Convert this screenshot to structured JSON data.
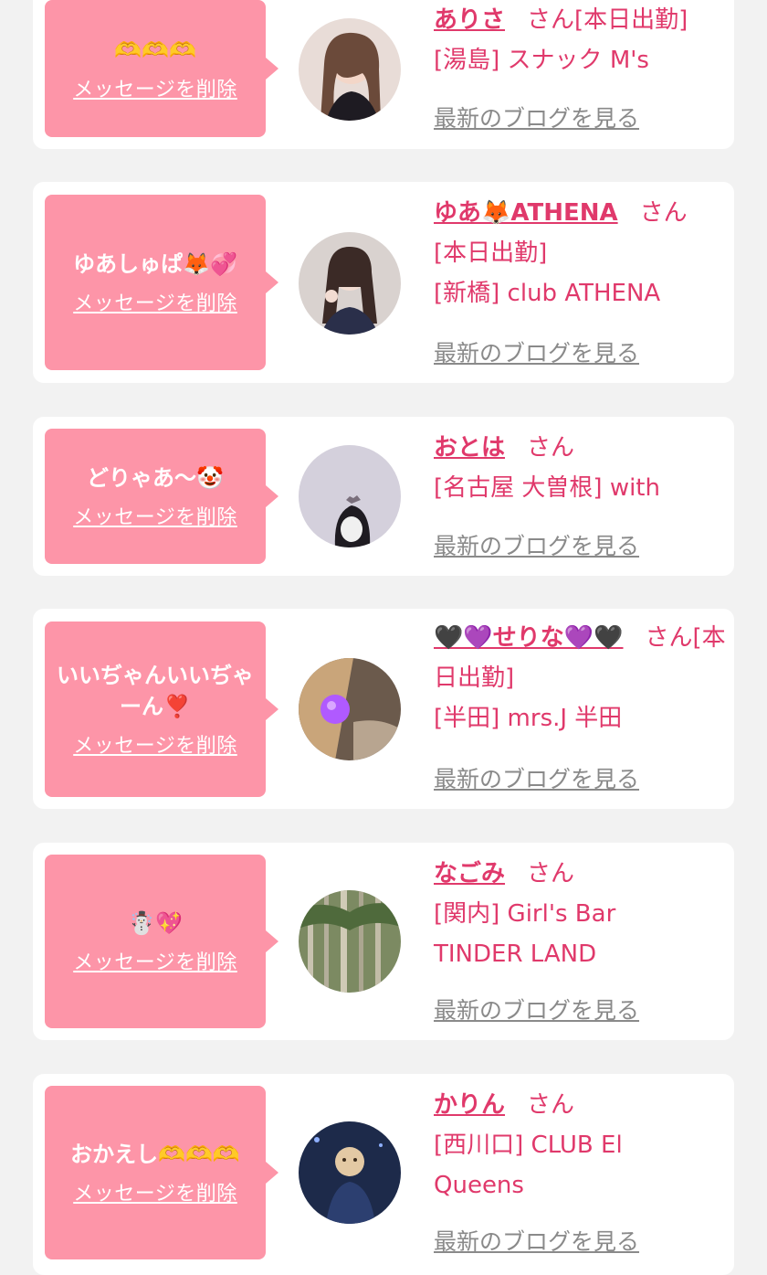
{
  "entries": [
    {
      "message": "🫶🫶🫶",
      "delete_label": "メッセージを削除",
      "name": "ありさ",
      "san": "さん",
      "lines": [
        "[本日出勤]",
        "[湯島] スナック M's"
      ],
      "blog_label": "最新のブログを見る"
    },
    {
      "message": "ゆあしゅぱ🦊💞",
      "delete_label": "メッセージを削除",
      "name": "ゆあ🦊ATHENA",
      "san": "さん",
      "lines": [
        "[本日出勤]",
        "[新橋] club ATHENA"
      ],
      "blog_label": "最新のブログを見る"
    },
    {
      "message": "どりゃあ〜🤡",
      "delete_label": "メッセージを削除",
      "name": "おとは",
      "san": "さん",
      "lines": [
        "[名古屋 大曽根] with"
      ],
      "blog_label": "最新のブログを見る"
    },
    {
      "message": "いいぢゃんいいぢゃーん❣️",
      "delete_label": "メッセージを削除",
      "name": "🖤💜せりな💜🖤",
      "san": "さん",
      "lines": [
        "[本日出勤]",
        "[半田] mrs.J 半田"
      ],
      "blog_label": "最新のブログを見る"
    },
    {
      "message": "☃️💖",
      "delete_label": "メッセージを削除",
      "name": "なごみ",
      "san": "さん",
      "lines": [
        "[関内] Girl's Bar",
        "TINDER LAND"
      ],
      "blog_label": "最新のブログを見る"
    },
    {
      "message": "おかえし🫶🫶🫶",
      "delete_label": "メッセージを削除",
      "name": "かりん",
      "san": "さん",
      "lines": [
        "[西川口] CLUB El",
        "Queens"
      ],
      "blog_label": "最新のブログを見る"
    }
  ],
  "colors": {
    "bubble": "#fd95a8",
    "name_pink": "#e0396b",
    "link_gray": "#8a8a8a",
    "background": "#f2f2f2"
  }
}
